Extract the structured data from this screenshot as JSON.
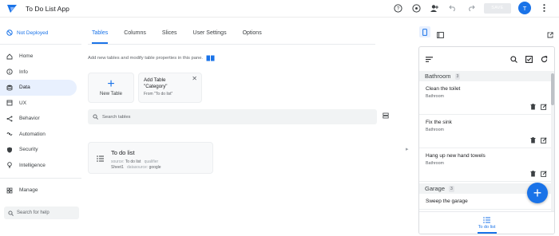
{
  "app": {
    "title": "To Do List App"
  },
  "topbar": {
    "save_label": "SAVE",
    "avatar_letter": "T"
  },
  "sidebar": {
    "deploy_status": "Not Deployed",
    "items": [
      {
        "label": "Home",
        "icon": "home-icon"
      },
      {
        "label": "Info",
        "icon": "info-icon"
      },
      {
        "label": "Data",
        "icon": "data-icon"
      },
      {
        "label": "UX",
        "icon": "ux-icon"
      },
      {
        "label": "Behavior",
        "icon": "behavior-icon"
      },
      {
        "label": "Automation",
        "icon": "automation-icon"
      },
      {
        "label": "Security",
        "icon": "shield-icon"
      },
      {
        "label": "Intelligence",
        "icon": "bulb-icon"
      }
    ],
    "manage": "Manage",
    "search_placeholder": "Search for help"
  },
  "main": {
    "tabs": [
      "Tables",
      "Columns",
      "Slices",
      "User Settings",
      "Options"
    ],
    "active_tab": "Tables",
    "intro": "Add new tables and modify table properties in this pane.",
    "new_table": "New Table",
    "suggestion": {
      "line1": "Add Table",
      "line2": "\"Category\"",
      "from": "From \"To do list\""
    },
    "search_placeholder": "Search tables",
    "table_card": {
      "name": "To do list",
      "source_label": "source:",
      "source_value": "To do list",
      "qualifier_label": "qualifier",
      "sheet": "Sheet1",
      "datasource_label": "datasource:",
      "datasource_value": "google"
    }
  },
  "preview": {
    "groups": [
      {
        "name": "Bathroom",
        "count": "3",
        "items": [
          {
            "title": "Clean the toilet",
            "category": "Bathroom"
          },
          {
            "title": "Fix the sink",
            "category": "Bathroom"
          },
          {
            "title": "Hang up new hand towels",
            "category": "Bathroom"
          }
        ]
      },
      {
        "name": "Garage",
        "count": "3",
        "items": [
          {
            "title": "Sweep the garage",
            "category": ""
          }
        ]
      }
    ],
    "nav_label": "To do list"
  },
  "colors": {
    "accent": "#1a73e8",
    "active_nav_bg": "#e8f0fe"
  }
}
